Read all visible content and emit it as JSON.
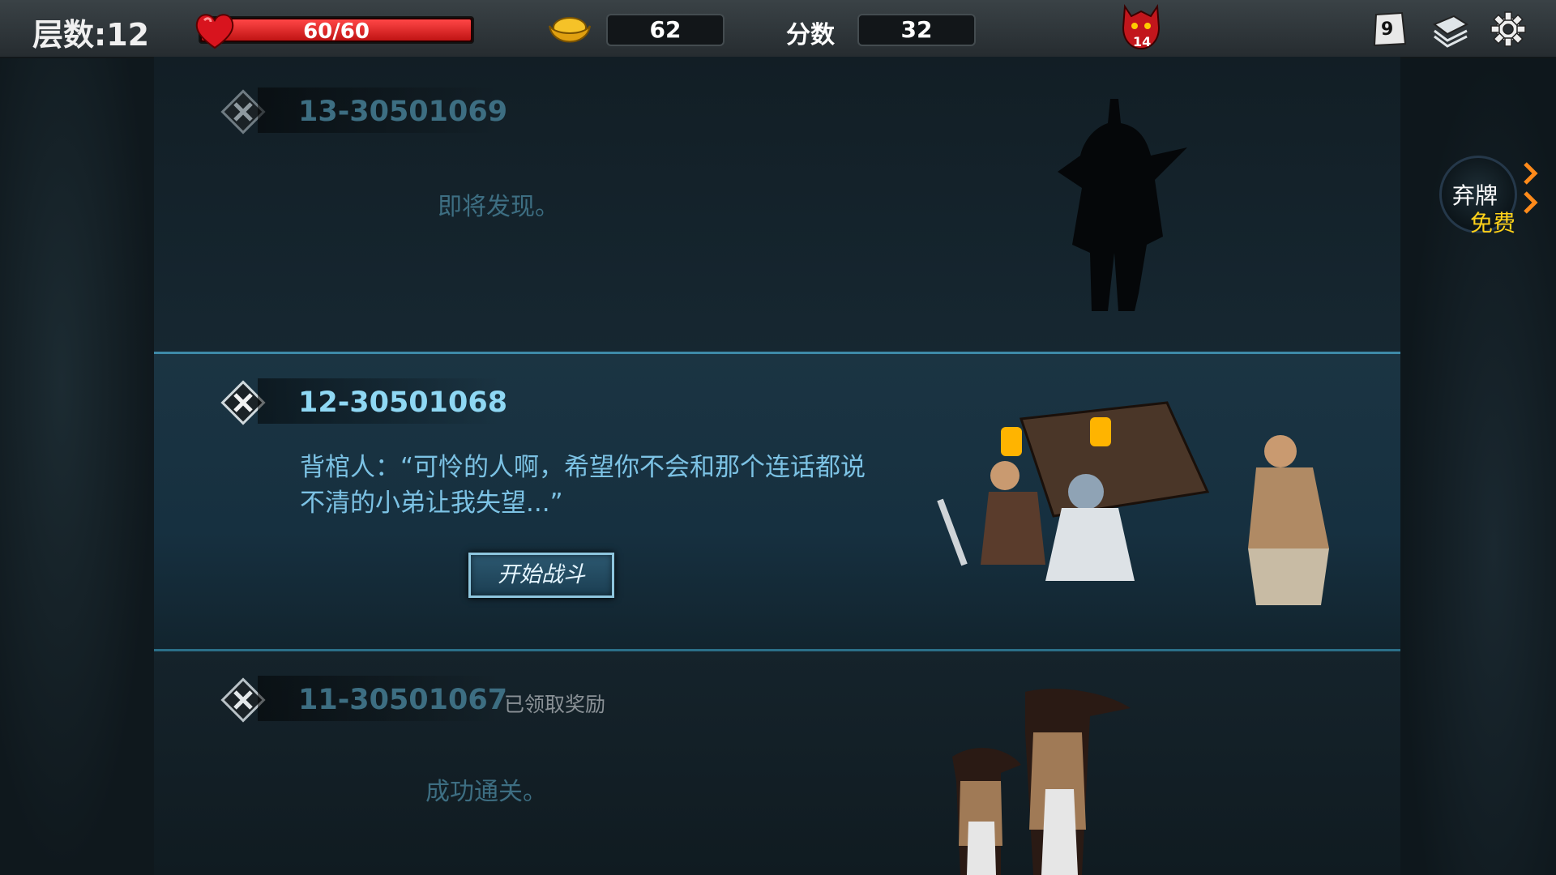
{
  "hud": {
    "floor_label": "层数:12",
    "hp": {
      "current": 60,
      "max": 60,
      "text": "60/60"
    },
    "gold": "62",
    "score_label": "分数",
    "score": "32",
    "boss_counter": "14",
    "deck_count": "9",
    "icons": [
      "heart-icon",
      "gold-ingot-icon",
      "demon-boss-icon",
      "card-deck-icon",
      "card-pile-icon",
      "gear-icon"
    ]
  },
  "events": [
    {
      "id": "13-30501069",
      "status": "",
      "text": "即将发现。",
      "state": "locked"
    },
    {
      "id": "12-30501068",
      "status": "",
      "text": "背棺人：“可怜的人啊，希望你不会和那个连话都说不清的小弟让我失望...”",
      "button": "开始战斗",
      "state": "current"
    },
    {
      "id": "11-30501067",
      "status": "已领取奖励",
      "text": "成功通关。",
      "state": "done"
    }
  ],
  "discard": {
    "label": "弃牌",
    "cost": "免费"
  },
  "colors": {
    "hp_red": "#e02020",
    "accent_cyan": "#8fd8f4",
    "dim_cyan": "#3d6e82",
    "free_yellow": "#ffd21a"
  }
}
